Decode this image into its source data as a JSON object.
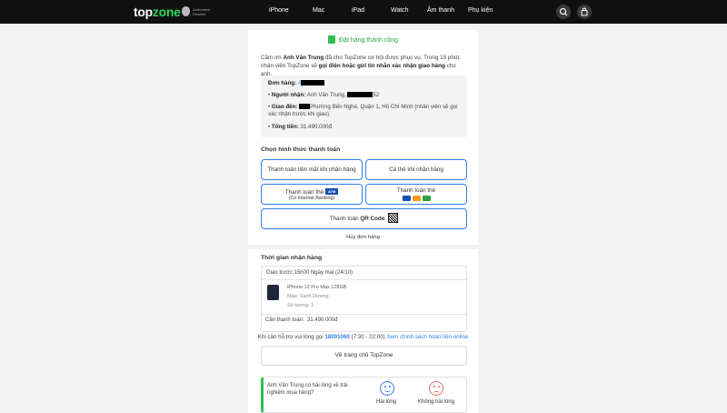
{
  "header": {
    "logo_prefix": "top",
    "logo_suffix": "zone",
    "apple_badge_text": "Authorized Reseller",
    "nav": [
      "iPhone",
      "Mac",
      "iPad",
      "Watch",
      "Âm thanh",
      "Phụ kiện"
    ],
    "icons": [
      "search-icon",
      "bag-icon"
    ]
  },
  "order": {
    "success_text": "Đặt hàng thành công",
    "thanks_pre": "Cảm ơn ",
    "customer": "Anh Văn Trung",
    "thanks_mid": " đã cho TopZone cơ hội được phục vụ. Trong 15 phút, nhân viên TopZone sẽ ",
    "thanks_bold": "gọi điện hoặc gửi tin nhắn xác nhận giao hàng",
    "thanks_post": " cho anh.",
    "order_label": "Đơn hàng:",
    "order_prefix": "#",
    "receiver_label": "Người nhận:",
    "receiver_value": "Anh Văn Trung,",
    "receiver_tail": "52",
    "delivery_label": "Giao đến:",
    "delivery_value": "Phường Bến Nghé, Quận 1, Hồ Chí Minh (nhân viên sẽ gọi xác nhận trước khi giao).",
    "total_label": "Tổng tiền:",
    "total_value": "31.490.000đ"
  },
  "payment": {
    "title": "Chọn hình thức thanh toán",
    "cash": "Thanh toán tiền mặt khi nhận hàng",
    "card_on_delivery": "Cà thẻ khi nhận hàng",
    "atm_label": "Thanh toán thẻ",
    "atm_badge": "ATM",
    "atm_sub": "(Có Internet Banking)",
    "intl_label": "Thanh toán thẻ",
    "qr_pre": "Thanh toán ",
    "qr_bold": "QR Code",
    "cancel": "Hủy đơn hàng"
  },
  "delivery": {
    "title": "Thời gian nhận hàng",
    "window": "Giao trước 15h00 Ngày mai (24/10)",
    "product_name": "iPhone 12 Pro Max 128GB",
    "product_color": "Màu: Xanh Dương",
    "product_qty": "Số lượng: 1",
    "need_pay_label": "Cần thanh toán:",
    "need_pay_value": "31.490.000đ"
  },
  "support": {
    "pre": "Khi cần hỗ trợ vui lòng gọi ",
    "hotline": "18001060",
    "hours": " (7:30 - 22:00) ",
    "refund_link": "Xem chính sách hoàn tiền online"
  },
  "home_button": "Về trang chủ TopZone",
  "feedback": {
    "question": "Anh Văn Trung có hài lòng về trải nghiệm mua hàng?",
    "happy": "Hài lòng",
    "unhappy": "Không hài lòng"
  },
  "colors": {
    "accent_blue": "#2f80ed",
    "success_green": "#2c9f48",
    "header_bg": "#101010"
  }
}
